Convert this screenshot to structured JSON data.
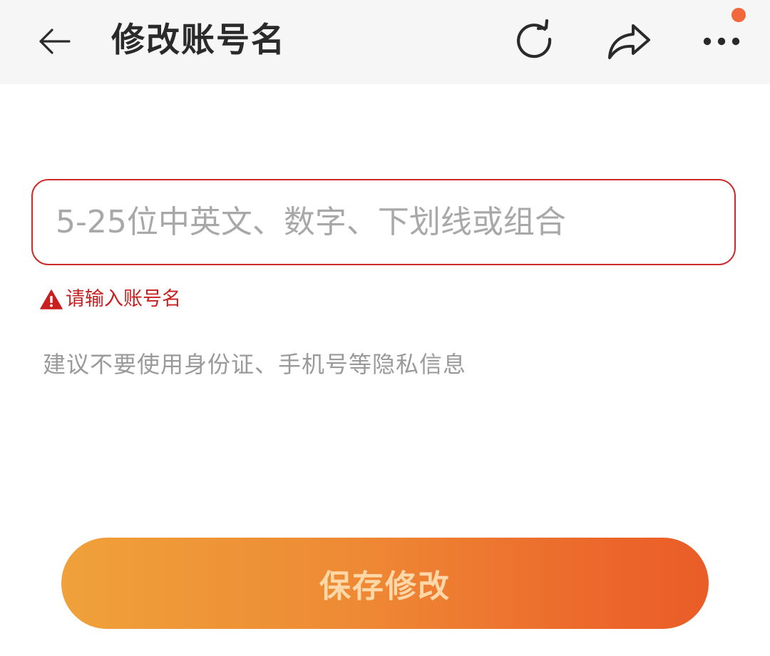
{
  "header": {
    "title": "修改账号名",
    "icons": {
      "back": "arrow-left-icon",
      "refresh": "refresh-icon",
      "share": "share-icon",
      "more": "more-dots-icon"
    },
    "notification_dot_color": "#f2683a"
  },
  "form": {
    "account_name_input": {
      "value": "",
      "placeholder": "5-25位中英文、数字、下划线或组合"
    },
    "error": {
      "icon": "warning-triangle-icon",
      "message": "请输入账号名",
      "color": "#c91f1f"
    },
    "hint": "建议不要使用身份证、手机号等隐私信息"
  },
  "actions": {
    "save_label": "保存修改",
    "gradient": [
      "#efa13a",
      "#ea5c28"
    ]
  }
}
